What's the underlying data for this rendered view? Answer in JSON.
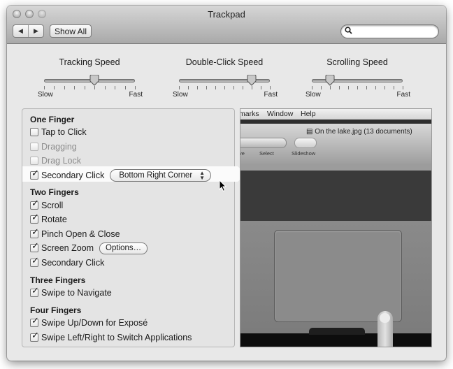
{
  "window": {
    "title": "Trackpad",
    "toolbar": {
      "back_icon": "triangle-left",
      "forward_icon": "triangle-right",
      "show_all_label": "Show All",
      "search_placeholder": "",
      "search_value": "",
      "search_icon": "magnifier"
    }
  },
  "sliders": [
    {
      "label": "Tracking Speed",
      "min_label": "Slow",
      "max_label": "Fast",
      "ticks": 10,
      "value_fraction": 0.55
    },
    {
      "label": "Double-Click Speed",
      "min_label": "Slow",
      "max_label": "Fast",
      "ticks": 11,
      "value_fraction": 0.8
    },
    {
      "label": "Scrolling Speed",
      "min_label": "Slow",
      "max_label": "Fast",
      "ticks": 11,
      "value_fraction": 0.2
    }
  ],
  "gestures": {
    "one_finger": {
      "title": "One Finger",
      "items": [
        {
          "label": "Tap to Click",
          "checked": false,
          "enabled": true
        },
        {
          "label": "Dragging",
          "checked": false,
          "enabled": false
        },
        {
          "label": "Drag Lock",
          "checked": false,
          "enabled": false
        },
        {
          "label": "Secondary Click",
          "checked": true,
          "enabled": true,
          "popup_value": "Bottom Right Corner"
        }
      ]
    },
    "two_fingers": {
      "title": "Two Fingers",
      "items": [
        {
          "label": "Scroll",
          "checked": true
        },
        {
          "label": "Rotate",
          "checked": true
        },
        {
          "label": "Pinch Open & Close",
          "checked": true
        },
        {
          "label": "Screen Zoom",
          "checked": true,
          "button_label": "Options…"
        },
        {
          "label": "Secondary Click",
          "checked": true
        }
      ]
    },
    "three_fingers": {
      "title": "Three Fingers",
      "items": [
        {
          "label": "Swipe to Navigate",
          "checked": true
        }
      ]
    },
    "four_fingers": {
      "title": "Four Fingers",
      "items": [
        {
          "label": "Swipe Up/Down for Exposé",
          "checked": true
        },
        {
          "label": "Swipe Left/Right to Switch Applications",
          "checked": true
        }
      ]
    }
  },
  "preview": {
    "menu_items": [
      "marks",
      "Window",
      "Help"
    ],
    "document_title": "On the lake.jpg (13 documents)",
    "toolbar_labels": [
      "ve",
      "Select",
      "Slideshow"
    ]
  },
  "check_glyph": "✓",
  "popup_arrows": [
    "▲",
    "▼"
  ]
}
